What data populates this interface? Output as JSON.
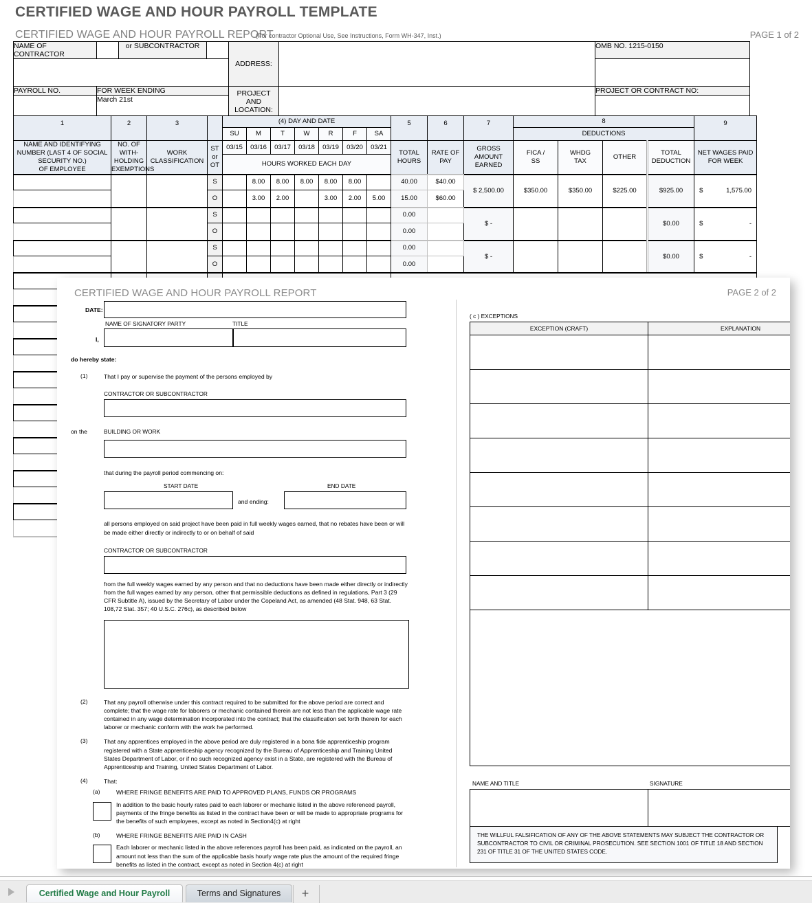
{
  "document": {
    "title": "CERTIFIED WAGE AND HOUR PAYROLL TEMPLATE"
  },
  "page1": {
    "report_title": "CERTIFIED WAGE AND HOUR PAYROLL REPORT",
    "note": "(For contractor Optional Use, See Instructions, Form WH-347, Inst.)",
    "page_label": "PAGE 1 of 2",
    "info": {
      "name_of_contractor": "NAME OF CONTRACTOR",
      "or_subcontractor": "or SUBCONTRACTOR",
      "address": "ADDRESS:",
      "omb": "OMB NO. 1215-0150",
      "payroll_no": "PAYROLL NO.",
      "for_week_ending": "FOR WEEK ENDING",
      "week_ending_value": "March 21st",
      "project_and_location": "PROJECT AND LOCATION:",
      "project_and_location_line1": "PROJECT AND",
      "project_and_location_line2": "LOCATION:",
      "project_or_contract_no": "PROJECT OR CONTRACT NO:"
    },
    "columns": {
      "n1": "1",
      "c1_l1": "NAME AND IDENTIFYING",
      "c1_l2": "NUMBER (LAST 4 OF SOCIAL",
      "c1_l3": "SECURITY NO.)",
      "c1_l4": "OF EMPLOYEE",
      "n2": "2",
      "c2_l1": "NO. OF",
      "c2_l2": "WITH-",
      "c2_l3": "HOLDING",
      "c2_l4": "EXEMPTIONS",
      "n3": "3",
      "c3_l1": "WORK",
      "c3_l2": "CLASSIFICATION",
      "st_l1": "ST",
      "st_l2": "or",
      "st_l3": "OT",
      "day_and_date": "(4) DAY AND DATE",
      "hours_worked": "HOURS WORKED EACH DAY",
      "n5": "5",
      "c5_l1": "TOTAL",
      "c5_l2": "HOURS",
      "n6": "6",
      "c6_l1": "RATE OF",
      "c6_l2": "PAY",
      "n7": "7",
      "c7_l1": "GROSS",
      "c7_l2": "AMOUNT",
      "c7_l3": "EARNED",
      "n8": "8",
      "deductions": "DEDUCTIONS",
      "d1_l1": "FICA /",
      "d1_l2": "SS",
      "d2_l1": "WHDG",
      "d2_l2": "TAX",
      "d3": "OTHER",
      "d4_l1": "TOTAL",
      "d4_l2": "DEDUCTION",
      "n9": "9",
      "c9_l1": "NET WAGES PAID",
      "c9_l2": "FOR WEEK"
    },
    "day_initials": [
      "SU",
      "M",
      "T",
      "W",
      "R",
      "F",
      "SA"
    ],
    "day_dates": [
      "03/15",
      "03/16",
      "03/17",
      "03/18",
      "03/19",
      "03/20",
      "03/21"
    ],
    "employee_rows": [
      {
        "st_label": "S",
        "ot_label": "O",
        "st_hours": [
          "",
          "8.00",
          "8.00",
          "8.00",
          "8.00",
          "8.00",
          ""
        ],
        "ot_hours": [
          "",
          "3.00",
          "2.00",
          "",
          "3.00",
          "2.00",
          "5.00"
        ],
        "st_total_hours": "40.00",
        "ot_total_hours": "15.00",
        "st_rate": "$40.00",
        "ot_rate": "$60.00",
        "gross": "$  2,500.00",
        "fica": "$350.00",
        "whdg": "$350.00",
        "other": "$225.00",
        "total_deduction": "$925.00",
        "net_currency": "$",
        "net_amount": "1,575.00"
      },
      {
        "st_label": "S",
        "ot_label": "O",
        "st_hours": [
          "",
          "",
          "",
          "",
          "",
          "",
          ""
        ],
        "ot_hours": [
          "",
          "",
          "",
          "",
          "",
          "",
          ""
        ],
        "st_total_hours": "0.00",
        "ot_total_hours": "0.00",
        "st_rate": "",
        "ot_rate": "",
        "gross": "$          -",
        "fica": "",
        "whdg": "",
        "other": "",
        "total_deduction": "$0.00",
        "net_currency": "$",
        "net_amount": "-"
      },
      {
        "st_label": "S",
        "ot_label": "O",
        "st_hours": [
          "",
          "",
          "",
          "",
          "",
          "",
          ""
        ],
        "ot_hours": [
          "",
          "",
          "",
          "",
          "",
          "",
          ""
        ],
        "st_total_hours": "0.00",
        "ot_total_hours": "0.00",
        "st_rate": "",
        "ot_rate": "",
        "gross": "$          -",
        "fica": "",
        "whdg": "",
        "other": "",
        "total_deduction": "$0.00",
        "net_currency": "$",
        "net_amount": "-"
      }
    ]
  },
  "page2": {
    "report_title": "CERTIFIED WAGE AND HOUR PAYROLL REPORT",
    "page_label": "PAGE 2 of 2",
    "date_label": "DATE:",
    "name_of_signatory_party": "NAME OF SIGNATORY PARTY",
    "title_label": "TITLE",
    "i_label": "I,",
    "do_hereby_state": "do hereby state:",
    "item1_num": "(1)",
    "item1_text": "That I pay or supervise the payment of the persons employed by",
    "contractor_or_subcontractor": "CONTRACTOR OR SUBCONTRACTOR",
    "on_the": "on the",
    "building_or_work": "BUILDING OR WORK",
    "commencing_on": "that during the payroll period commencing on:",
    "start_date_label": "START DATE",
    "end_date_label": "END DATE",
    "and_ending": "and ending:",
    "para_paid": "all persons employed on said project have been paid in full weekly wages earned, that no rebates have been or will be made either directly or indirectly to or on behalf of said",
    "contractor_or_subcontractor2": "CONTRACTOR OR SUBCONTRACTOR",
    "para_deductions": "from the full weekly wages earned by any person and that no deductions have been made either directly or indirectly from the full wages earned by any person, other that permissible deductions as defined in regulations, Part 3 (29 CFR Subtitle A), issued by the Secretary of Labor under the Copeland Act, as amended (48 Stat. 948, 63 Stat. 108,72 Stat. 357; 40 U.S.C. 276c), as described below",
    "item2_num": "(2)",
    "item2_text": "That any payroll otherwise under this contract required to be submitted for the above period are correct and complete; that the wage rate for laborers or mechanic contained therein are not less than the applicable wage rate contained in any wage determination incorporated into the contract; that the classification set forth therein for each laborer or mechanic conform with the work he performed.",
    "item3_num": "(3)",
    "item3_text": "That any apprentices employed in the above period are duly registered in a bona fide apprenticeship program registered with a State apprenticeship agency recognized by the Bureau of Apprenticeship and Training United States Department of Labor, or if no such recognized agency exist in a State, are registered with the Bureau of Apprenticeship and Training, United States Department of Labor.",
    "item4_num": "(4)",
    "item4_text": "That:",
    "item4a_num": "(a)",
    "item4a_title": "WHERE FRINGE BENEFITS ARE PAID TO APPROVED PLANS, FUNDS OR PROGRAMS",
    "item4a_text": "In addition to the basic hourly rates paid to each laborer or mechanic listed in the above referenced payroll, payments of the fringe benefits as listed in the contract have been or will be made to appropriate programs for the benefits of such employees, except as noted in Section4(c) at right",
    "item4b_num": "(b)",
    "item4b_title": "WHERE FRINGE BENEFITS ARE PAID IN CASH",
    "item4b_text": "Each laborer or mechanic listed in the above references payroll has been paid, as indicated on the payroll, an amount not less than the sum of the applicable basis hourly wage rate plus the amount of the required fringe benefits as listed in the contract, except as noted in Section 4(c) at right",
    "exceptions_label": "( c ) EXCEPTIONS",
    "exception_headers": [
      "EXCEPTION (CRAFT)",
      "EXPLANATION"
    ],
    "exception_rows": [
      {
        "craft": "",
        "explanation": ""
      },
      {
        "craft": "",
        "explanation": ""
      },
      {
        "craft": "",
        "explanation": ""
      },
      {
        "craft": "",
        "explanation": ""
      },
      {
        "craft": "",
        "explanation": ""
      },
      {
        "craft": "",
        "explanation": ""
      },
      {
        "craft": "",
        "explanation": ""
      },
      {
        "craft": "",
        "explanation": ""
      }
    ],
    "name_and_title_label": "NAME AND TITLE",
    "signature_label": "SIGNATURE",
    "warning_text": "THE WILLFUL FALSIFICATION OF ANY OF THE ABOVE STATEMENTS MAY SUBJECT THE CONTRACTOR OR SUBCONTRACTOR TO CIVIL OR CRIMINAL PROSECUTION. SEE SECTION 1001 OF TITLE 18 AND SECTION 231 OF TITLE 31 OF THE UNITED STATES CODE."
  },
  "tabbar": {
    "tabs": [
      {
        "label": "Certified Wage and Hour Payroll",
        "active": true
      },
      {
        "label": "Terms and Signatures",
        "active": false
      }
    ],
    "add_sheet_label": "+"
  },
  "colors": {
    "header_shade": "#e8edf4",
    "label_shade": "#f2f2f2",
    "active_tab_text": "#1f7a45",
    "title_gray": "#595959"
  }
}
